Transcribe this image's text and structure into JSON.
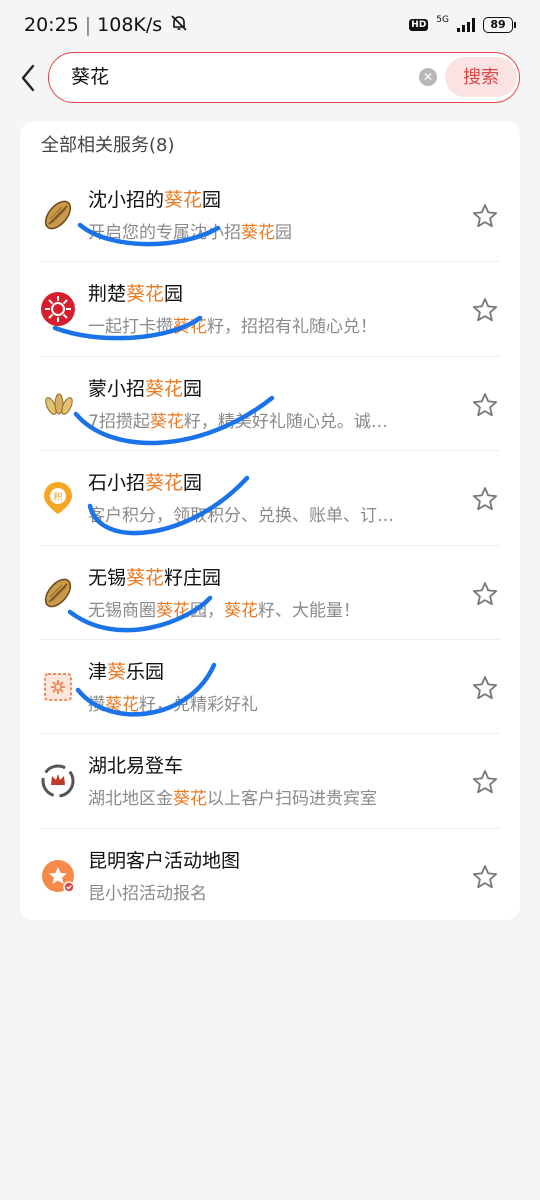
{
  "status_bar": {
    "time": "20:25",
    "net_speed": "108K/s",
    "hd": "HD",
    "network": "5G",
    "battery": "89"
  },
  "search": {
    "query": "葵花",
    "button_label": "搜索"
  },
  "results": {
    "section_title": "全部相关服务(8)",
    "items": [
      {
        "title": "沈小招的葵花园",
        "title_parts": [
          {
            "t": "沈小招的"
          },
          {
            "t": "葵花",
            "hl": true
          },
          {
            "t": "园"
          }
        ],
        "desc": "开启您的专属沈小招葵花园",
        "desc_parts": [
          {
            "t": "开启您的专属沈小招"
          },
          {
            "t": "葵花",
            "hl": true
          },
          {
            "t": "园"
          }
        ],
        "icon": "sunflower-seed-icon"
      },
      {
        "title": "荆楚葵花园",
        "title_parts": [
          {
            "t": "荆楚"
          },
          {
            "t": "葵花",
            "hl": true
          },
          {
            "t": "园"
          }
        ],
        "desc": "一起打卡攒葵花籽，招招有礼随心兑！",
        "desc_parts": [
          {
            "t": "一起打卡攒"
          },
          {
            "t": "葵花",
            "hl": true
          },
          {
            "t": "籽，招招有礼随心兑！"
          }
        ],
        "icon": "red-sunflower-badge-icon"
      },
      {
        "title": "蒙小招葵花园",
        "title_parts": [
          {
            "t": "蒙小招"
          },
          {
            "t": "葵花",
            "hl": true
          },
          {
            "t": "园"
          }
        ],
        "desc": "7招攒起葵花籽，精美好礼随心兑。诚…",
        "desc_parts": [
          {
            "t": "7招攒起"
          },
          {
            "t": "葵花",
            "hl": true
          },
          {
            "t": "籽，精美好礼随心兑。诚…"
          }
        ],
        "icon": "seed-cluster-icon"
      },
      {
        "title": "石小招葵花园",
        "title_parts": [
          {
            "t": "石小招"
          },
          {
            "t": "葵花",
            "hl": true
          },
          {
            "t": "园"
          }
        ],
        "desc": "客户积分，领取积分、兑换、账单、订…",
        "desc_parts": [
          {
            "t": "客户积分，领取积分、兑换、账单、订…"
          }
        ],
        "icon": "points-pin-icon"
      },
      {
        "title": "无锡葵花籽庄园",
        "title_parts": [
          {
            "t": "无锡"
          },
          {
            "t": "葵花",
            "hl": true
          },
          {
            "t": "籽庄园"
          }
        ],
        "desc": "无锡商圈葵花园，葵花籽、大能量！",
        "desc_parts": [
          {
            "t": "无锡商圈"
          },
          {
            "t": "葵花",
            "hl": true
          },
          {
            "t": "园，"
          },
          {
            "t": "葵花",
            "hl": true
          },
          {
            "t": "籽、大能量！"
          }
        ],
        "icon": "sunflower-seed-icon"
      },
      {
        "title": "津葵乐园",
        "title_parts": [
          {
            "t": "津"
          },
          {
            "t": "葵",
            "hl": true
          },
          {
            "t": "乐园"
          }
        ],
        "desc": "攒葵花籽，兑精彩好礼",
        "desc_parts": [
          {
            "t": "攒"
          },
          {
            "t": "葵花",
            "hl": true
          },
          {
            "t": "籽，兑精彩好礼"
          }
        ],
        "icon": "flower-stamp-icon"
      },
      {
        "title": "湖北易登车",
        "title_parts": [
          {
            "t": "湖北易登车"
          }
        ],
        "desc": "湖北地区金葵花以上客户扫码进贵宾室",
        "desc_parts": [
          {
            "t": "湖北地区金"
          },
          {
            "t": "葵花",
            "hl": true
          },
          {
            "t": "以上客户扫码进贵宾室"
          }
        ],
        "icon": "crown-circle-icon"
      },
      {
        "title": "昆明客户活动地图",
        "title_parts": [
          {
            "t": "昆明客户活动地图"
          }
        ],
        "desc": "昆小招活动报名",
        "desc_parts": [
          {
            "t": "昆小招活动报名"
          }
        ],
        "icon": "star-badge-icon"
      }
    ]
  },
  "colors": {
    "accent": "#e04646",
    "highlight": "#ec7a22",
    "scribble": "#1a73e8"
  }
}
